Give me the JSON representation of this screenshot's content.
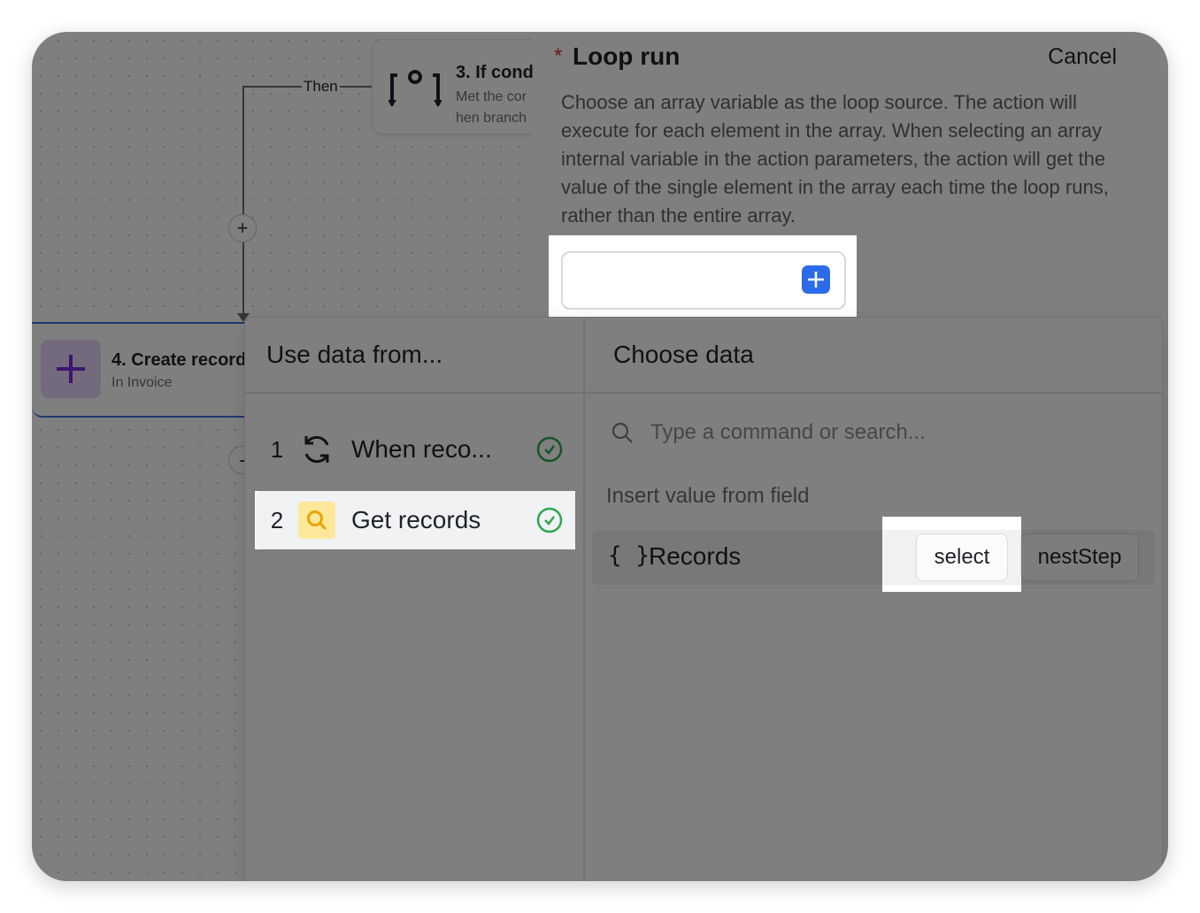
{
  "canvas": {
    "then_label": "Then",
    "if_card": {
      "title": "3. If cond",
      "sub1": "Met the cor",
      "sub2": "hen branch"
    },
    "create_card": {
      "title": "4. Create record",
      "sub": "In Invoice"
    },
    "add_node_symbol": "+",
    "collapse_node_symbol": "-"
  },
  "panel": {
    "title": "Loop run",
    "required_mark": "*",
    "cancel_label": "Cancel",
    "description": "Choose an array variable as the loop source. The action will execute for each element in the array. When selecting an array internal variable in the action parameters, the action will get the value of the single element in the array each time the loop runs, rather than the entire array.",
    "array_input_value": "",
    "add_button_icon": "plus-icon"
  },
  "picker": {
    "left_heading": "Use data from...",
    "right_heading": "Choose data",
    "steps": [
      {
        "number": "1",
        "label": "When reco...",
        "icon": "refresh-icon",
        "status": "complete"
      },
      {
        "number": "2",
        "label": "Get records",
        "icon": "search-icon",
        "status": "complete",
        "selected": true
      }
    ],
    "search_placeholder": "Type a command or search...",
    "insert_label": "Insert value from field",
    "field": {
      "braces": "{ }",
      "name": "Records",
      "select_label": "select",
      "nest_label": "nestStep"
    }
  },
  "colors": {
    "accent_blue": "#2b6bea",
    "success_green": "#2fa84f",
    "required_red": "#d0312d",
    "create_icon_bg": "#e9d5fb",
    "get_records_icon_bg": "#fde79a"
  }
}
